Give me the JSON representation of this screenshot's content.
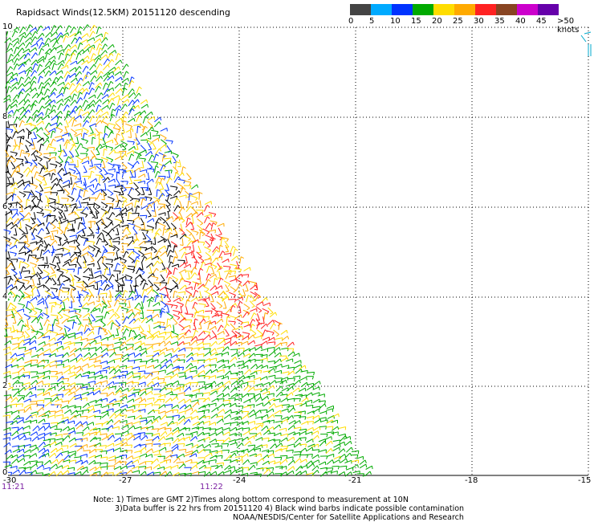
{
  "title": "Rapidsact Winds(12.5KM) 20151120 descending",
  "legend": {
    "colors": [
      "#444444",
      "#00aaff",
      "#0033ff",
      "#00aa00",
      "#ffdd00",
      "#ffaa00",
      "#ff2222",
      "#884422",
      "#cc00cc",
      "#6600aa"
    ],
    "labels": [
      "0",
      "5",
      "10",
      "15",
      "20",
      "25",
      "30",
      "35",
      "40",
      "45",
      ">50 knots"
    ]
  },
  "map": {
    "lat_labels": [
      "10",
      "8",
      "6",
      "4",
      "2",
      "0"
    ],
    "lon_labels": [
      "-30",
      "-27",
      "-24",
      "-21",
      "-18",
      "-15"
    ],
    "time_labels": [
      "11:21",
      "11:22"
    ]
  },
  "notes": {
    "line1": "Note: 1) Times are GMT 2)Times along bottom correspond to measurement at 10N",
    "line2": "3)Data buffer is 22 hrs from 20151120 4) Black wind barbs indicate possible contamination",
    "line3": "NOAA/NESDIS/Center for Satellite Applications and Research"
  }
}
